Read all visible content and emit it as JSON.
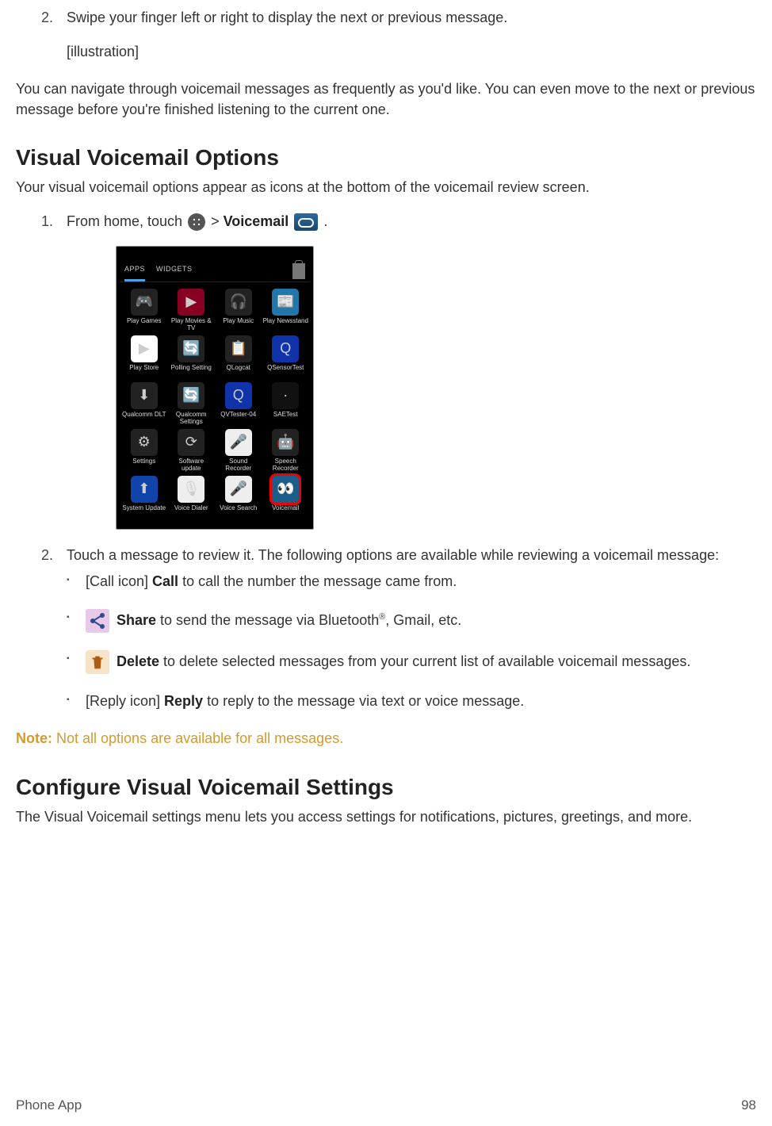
{
  "top_block": {
    "step2_number": "2.",
    "step2_text": "Swipe your finger left or right to display the next or previous message.",
    "illustration_label": "[illustration]",
    "nav_text": "You can navigate through voicemail messages as frequently as you'd like. You can even move to the next or previous message before you're finished listening to the current one."
  },
  "options_section": {
    "heading": "Visual Voicemail Options",
    "intro": "Your visual voicemail options appear as icons at the bottom of the voicemail review screen.",
    "step1_prefix": "From home, touch ",
    "step1_mid": " > ",
    "step1_bold": "Voicemail",
    "step1_suffix": ".",
    "step2": "Touch a message to review it. The following options are available while reviewing a voicemail message:",
    "bullets": {
      "call_prefix": "[Call icon] ",
      "call_bold": "Call",
      "call_rest": " to call the number the message came from.",
      "share_bold": "Share",
      "share_rest_a": " to send the message via Bluetooth",
      "share_rest_b": ", Gmail, etc.",
      "delete_bold": "Delete",
      "delete_rest": " to delete selected messages from your current list of available voicemail messages.",
      "reply_prefix": "[Reply icon] ",
      "reply_bold": "Reply",
      "reply_rest": " to reply to the message via text or voice message."
    },
    "note_label": "Note:",
    "note_text": " Not all options are available for all messages."
  },
  "configure_section": {
    "heading": "Configure Visual Voicemail Settings",
    "body": "The Visual Voicemail settings menu lets you access settings for notifications, pictures, greetings, and more."
  },
  "phone": {
    "tab_apps": "APPS",
    "tab_widgets": "WIDGETS",
    "apps": [
      {
        "lbl": "Play Games",
        "bg": "#222",
        "glyph": "🎮"
      },
      {
        "lbl": "Play Movies & TV",
        "bg": "#802",
        "glyph": "▶"
      },
      {
        "lbl": "Play Music",
        "bg": "#222",
        "glyph": "🎧"
      },
      {
        "lbl": "Play Newsstand",
        "bg": "#27a",
        "glyph": "📰"
      },
      {
        "lbl": "Play Store",
        "bg": "#fff",
        "glyph": "▶"
      },
      {
        "lbl": "Polling Setting",
        "bg": "#222",
        "glyph": "🔄"
      },
      {
        "lbl": "QLogcat",
        "bg": "#222",
        "glyph": "📋"
      },
      {
        "lbl": "QSensorTest",
        "bg": "#13a",
        "glyph": "Q"
      },
      {
        "lbl": "Qualcomm DLT",
        "bg": "#222",
        "glyph": "⬇"
      },
      {
        "lbl": "Qualcomm Settings",
        "bg": "#222",
        "glyph": "🔄"
      },
      {
        "lbl": "QVTester-04",
        "bg": "#13a",
        "glyph": "Q"
      },
      {
        "lbl": "SAETest",
        "bg": "#111",
        "glyph": "·"
      },
      {
        "lbl": "Settings",
        "bg": "#222",
        "glyph": "⚙"
      },
      {
        "lbl": "Software update",
        "bg": "#222",
        "glyph": "⟳"
      },
      {
        "lbl": "Sound Recorder",
        "bg": "#eee",
        "glyph": "🎤"
      },
      {
        "lbl": "Speech Recorder",
        "bg": "#222",
        "glyph": "🤖"
      },
      {
        "lbl": "System Update",
        "bg": "#14a",
        "glyph": "⬆"
      },
      {
        "lbl": "Voice Dialer",
        "bg": "#eee",
        "glyph": "🎙"
      },
      {
        "lbl": "Voice Search",
        "bg": "#eee",
        "glyph": "🎤"
      },
      {
        "lbl": "Voicemail",
        "bg": "#1b5e8a",
        "glyph": "👀",
        "sel": true
      }
    ]
  },
  "footer": {
    "section": "Phone App",
    "page": "98"
  }
}
